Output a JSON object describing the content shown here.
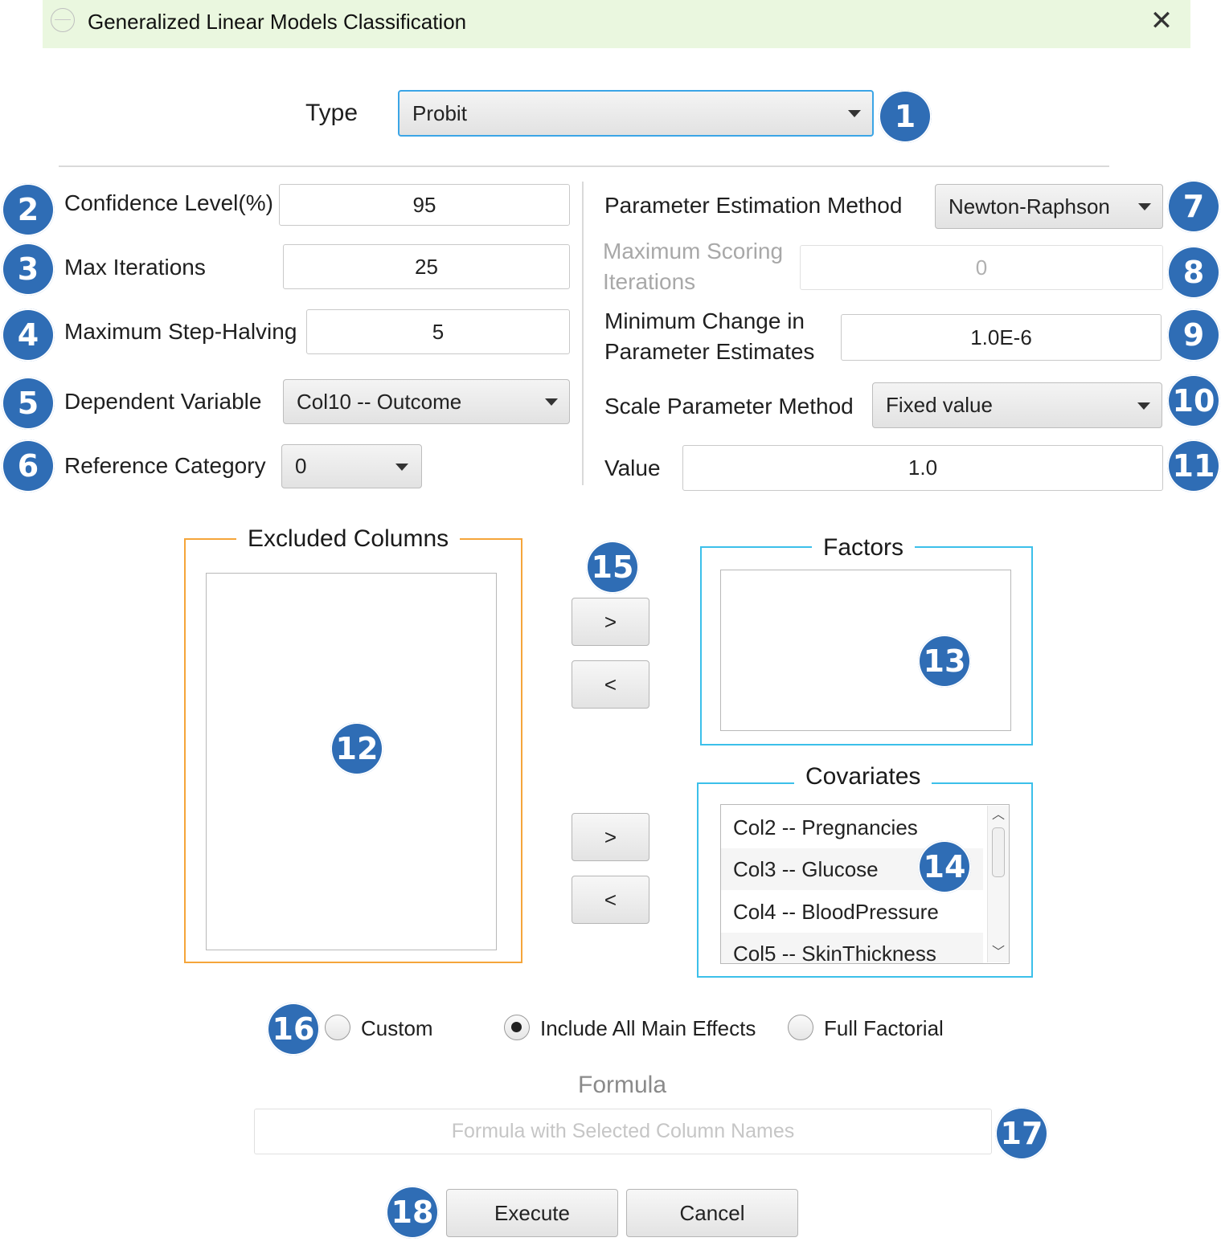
{
  "window": {
    "title": "Generalized Linear Models Classification"
  },
  "type": {
    "label": "Type",
    "value": "Probit"
  },
  "left_params": {
    "confidence_label": "Confidence Level(%)",
    "confidence_value": "95",
    "max_iter_label": "Max Iterations",
    "max_iter_value": "25",
    "step_halving_label": "Maximum Step-Halving",
    "step_halving_value": "5",
    "dependent_label": "Dependent Variable",
    "dependent_value": "Col10 -- Outcome",
    "reference_label": "Reference Category",
    "reference_value": "0"
  },
  "right_params": {
    "estimation_label": "Parameter Estimation Method",
    "estimation_value": "Newton-Raphson",
    "scoring_label_1": "Maximum Scoring",
    "scoring_label_2": "Iterations",
    "scoring_value": "0",
    "min_change_label_1": "Minimum Change in",
    "min_change_label_2": "Parameter Estimates",
    "min_change_value": "1.0E-6",
    "scale_label": "Scale Parameter Method",
    "scale_value": "Fixed value",
    "value_label": "Value",
    "value_value": "1.0"
  },
  "excluded": {
    "title": "Excluded Columns"
  },
  "factors": {
    "title": "Factors"
  },
  "covariates": {
    "title": "Covariates",
    "items": [
      "Col2 -- Pregnancies",
      "Col3 -- Glucose",
      "Col4 -- BloodPressure",
      "Col5 -- SkinThickness"
    ]
  },
  "transfer": {
    "add": ">",
    "remove": "<"
  },
  "model": {
    "custom": "Custom",
    "main_effects": "Include All Main Effects",
    "full_factorial": "Full Factorial",
    "selected": "main_effects"
  },
  "formula": {
    "label": "Formula",
    "placeholder": "Formula with Selected Column Names"
  },
  "actions": {
    "execute": "Execute",
    "cancel": "Cancel"
  },
  "badges": [
    "1",
    "2",
    "3",
    "4",
    "5",
    "6",
    "7",
    "8",
    "9",
    "10",
    "11",
    "12",
    "13",
    "14",
    "15",
    "16",
    "17",
    "18"
  ],
  "colors": {
    "badge": "#2f6db5",
    "excluded_border": "#f5a53a",
    "factor_border": "#3cc0ea",
    "title_bar": "#eaf7df",
    "focus": "#3ba5e6"
  }
}
